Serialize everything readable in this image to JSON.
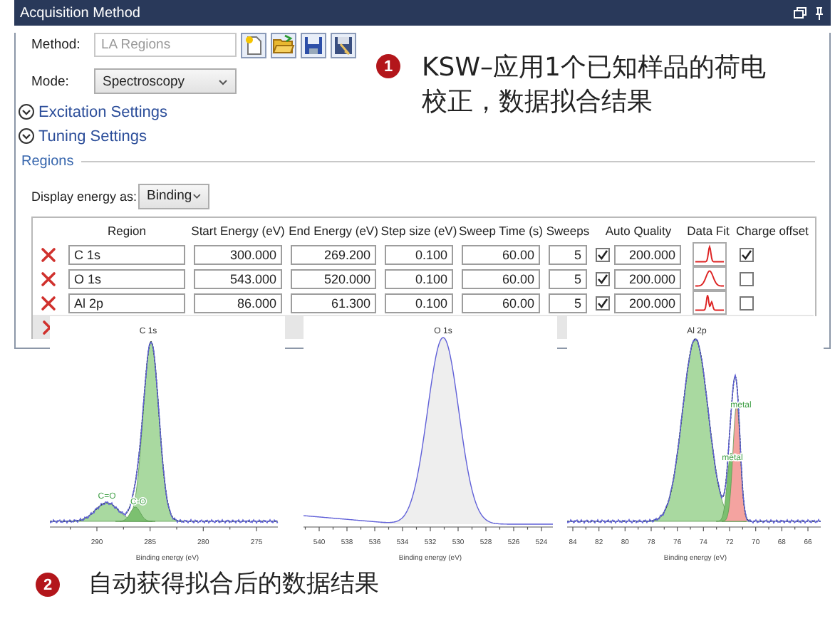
{
  "window": {
    "title": "Acquisition Method"
  },
  "method": {
    "label": "Method:",
    "value": "LA Regions",
    "disabled": true
  },
  "mode": {
    "label": "Mode:",
    "value": "Spectroscopy"
  },
  "sections": [
    {
      "label": "Excitation Settings",
      "expanded": false
    },
    {
      "label": "Tuning Settings",
      "expanded": false
    }
  ],
  "regions": {
    "title": "Regions",
    "display_label": "Display energy as:",
    "display_value": "Binding",
    "columns": [
      "Region",
      "Start Energy (eV)",
      "End Energy (eV)",
      "Step size (eV)",
      "Sweep Time (s)",
      "Sweeps",
      "Auto Quality",
      "Data Fit",
      "Charge offset"
    ],
    "rows": [
      {
        "region": "C 1s",
        "start": "300.000",
        "end": "269.200",
        "step": "0.100",
        "sweep_time": "60.00",
        "sweeps": "5",
        "auto_quality": true,
        "quality": "200.000",
        "fit": {
          "kind": "narrow"
        },
        "charge_offset": true
      },
      {
        "region": "O 1s",
        "start": "543.000",
        "end": "520.000",
        "step": "0.100",
        "sweep_time": "60.00",
        "sweeps": "5",
        "auto_quality": true,
        "quality": "200.000",
        "fit": {
          "kind": "broad"
        },
        "charge_offset": false
      },
      {
        "region": "Al 2p",
        "start": "86.000",
        "end": "61.300",
        "step": "0.100",
        "sweep_time": "60.00",
        "sweeps": "5",
        "auto_quality": true,
        "quality": "200.000",
        "fit": {
          "kind": "doublet"
        },
        "charge_offset": false
      }
    ],
    "covered_row": true
  },
  "charts": [
    {
      "kind": "multi",
      "title": "C 1s",
      "ticks": [
        "290",
        "285",
        "280",
        "275"
      ],
      "xlabel": "Binding energy (eV)",
      "peak_labels": [
        "C=O",
        "C-O"
      ]
    },
    {
      "kind": "single",
      "title": "O 1s",
      "ticks": [
        "540",
        "538",
        "536",
        "534",
        "532",
        "530",
        "528",
        "526",
        "524"
      ],
      "xlabel": "Binding energy (eV)"
    },
    {
      "kind": "doublet",
      "title": "Al 2p",
      "ticks": [
        "84",
        "82",
        "80",
        "78",
        "76",
        "74",
        "72",
        "70",
        "68",
        "66"
      ],
      "xlabel": "Binding energy (eV)",
      "peak_labels": [
        "metal",
        "metal"
      ]
    }
  ],
  "notes": [
    {
      "number": "1",
      "text": "KSW–应用1个已知样品的荷电校正，数据拟合结果"
    },
    {
      "number": "2",
      "text": "自动获得拟合后的数据结果"
    }
  ]
}
